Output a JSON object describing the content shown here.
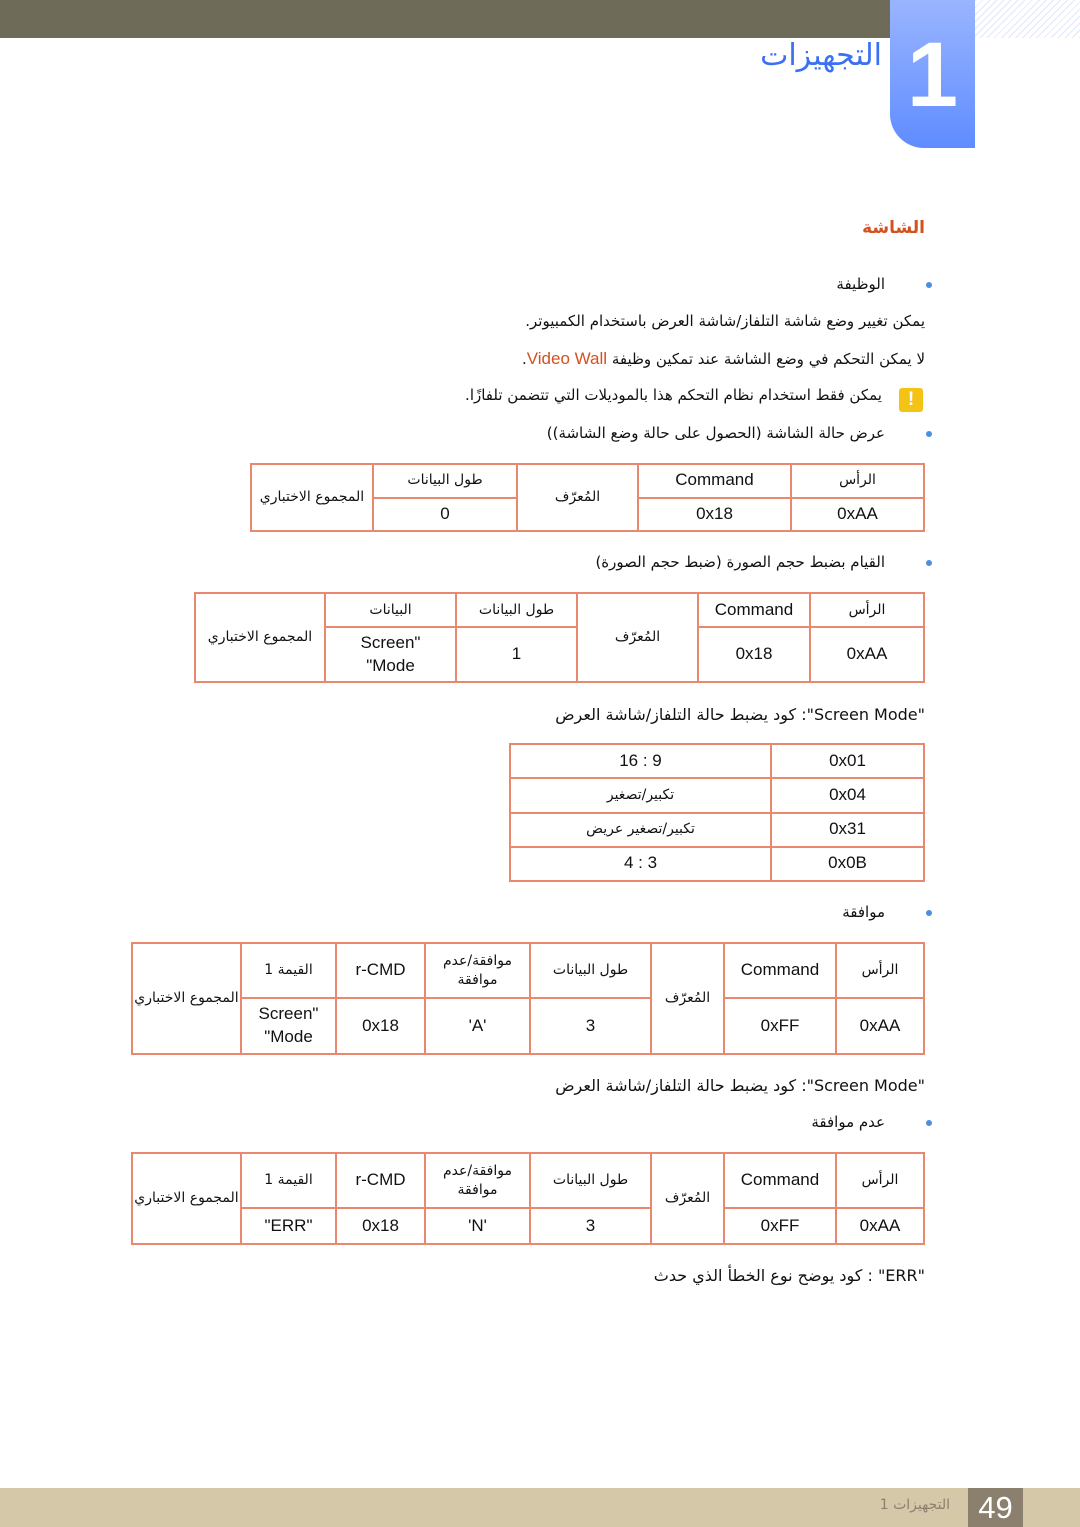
{
  "header": {
    "chapter_number": "1",
    "chapter_title": "التجهيزات"
  },
  "section_title": "الشاشة",
  "function_label": "الوظيفة",
  "desc1": "يمكن تغيير وضع شاشة التلفاز/شاشة العرض باستخدام الكمبيوتر.",
  "desc2_prefix": "لا يمكن التحكم في وضع الشاشة عند تمكين وظيفة ",
  "desc2_link": "Video Wall",
  "desc2_suffix": ".",
  "note": "يمكن فقط استخدام نظام التحكم هذا بالموديلات التي تتضمن تلفازًا.",
  "bullet_get": "عرض حالة الشاشة (الحصول على حالة وضع الشاشة))",
  "table_get": {
    "headers": [
      "الرأس",
      "Command",
      "المُعرّف",
      "طول البيانات",
      "المجموع الاختباري"
    ],
    "values": [
      "0xAA",
      "0x18",
      "0"
    ]
  },
  "bullet_set": "القيام بضبط حجم الصورة (ضبط حجم الصورة)",
  "table_set": {
    "headers": [
      "الرأس",
      "Command",
      "المُعرّف",
      "طول البيانات",
      "البيانات",
      "المجموع الاختباري"
    ],
    "values": [
      "0xAA",
      "0x18",
      "1",
      "Screen\"",
      "\"Mode"
    ]
  },
  "screen_mode_note": "\"Screen Mode\": كود يضبط حالة التلفاز/شاشة العرض",
  "mode_table": [
    {
      "code": "0x01",
      "label": "16 : 9"
    },
    {
      "code": "0x04",
      "label": "تكبير/تصغير"
    },
    {
      "code": "0x31",
      "label": "تكبير/تصغير عريض"
    },
    {
      "code": "0x0B",
      "label": "4 : 3"
    }
  ],
  "ack_label": "موافقة",
  "table_ack": {
    "headers": [
      "الرأس",
      "Command",
      "المُعرّف",
      "طول البيانات",
      "موافقة/عدم موافقة",
      "r-CMD",
      "القيمة 1",
      "المجموع الاختباري"
    ],
    "values": [
      "0xAA",
      "0xFF",
      "3",
      "'A'",
      "0x18",
      "Screen\"",
      "\"Mode"
    ]
  },
  "screen_mode_note2": "\"Screen Mode\": كود يضبط حالة التلفاز/شاشة العرض",
  "nak_label": "عدم موافقة",
  "table_nak": {
    "headers": [
      "الرأس",
      "Command",
      "المُعرّف",
      "طول البيانات",
      "موافقة/عدم موافقة",
      "r-CMD",
      "القيمة 1",
      "المجموع الاختباري"
    ],
    "values": [
      "0xAA",
      "0xFF",
      "3",
      "'N'",
      "0x18",
      "\"ERR\""
    ]
  },
  "err_note": "\"ERR\" : كود يوضح نوع الخطأ الذي حدث",
  "footer": {
    "page_number": "49",
    "label": "التجهيزات 1"
  },
  "colors": {
    "accent_blue": "#3b70f2",
    "section_orange": "#d4501e",
    "table_outer": "#8b7a3e",
    "table_inner": "#e8896f"
  }
}
